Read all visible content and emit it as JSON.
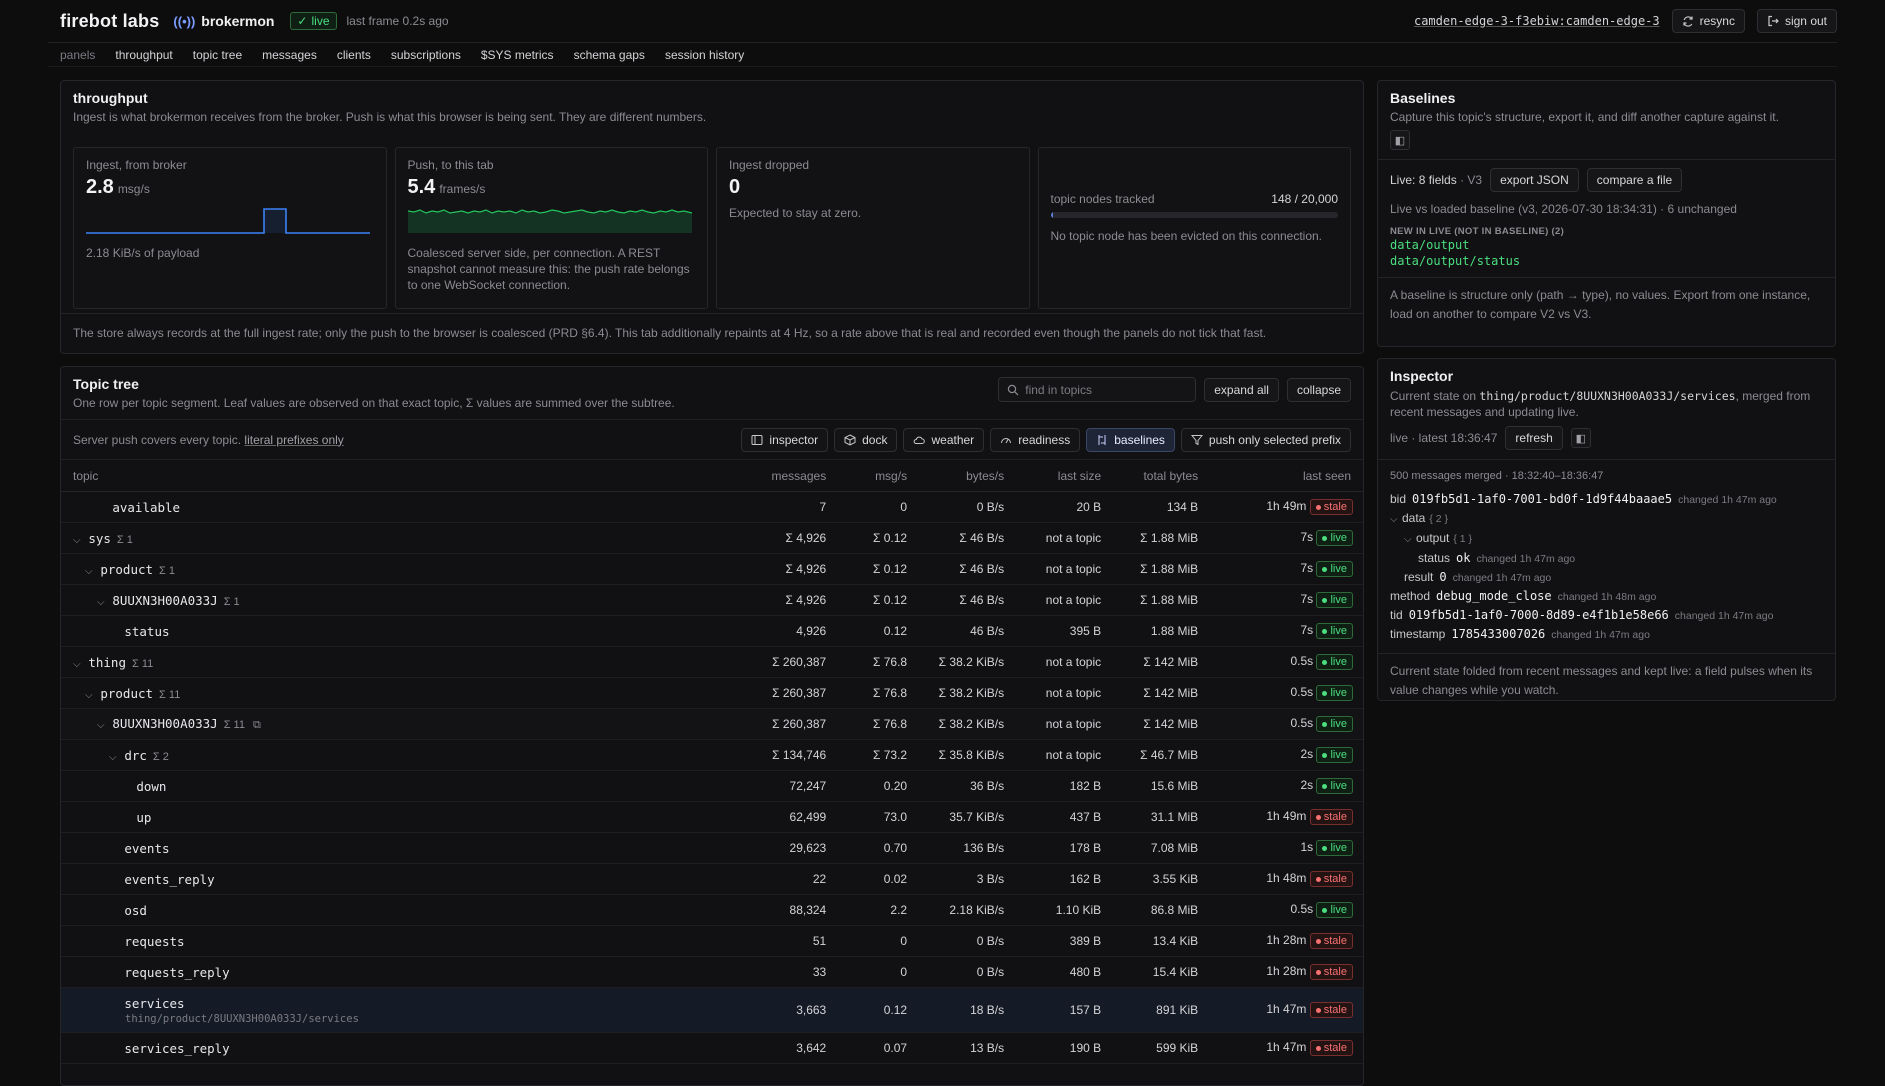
{
  "header": {
    "brand": "firebot labs",
    "app": "brokermon",
    "live_label": "live",
    "last_frame": "last frame 0.2s ago",
    "edge_id": "camden-edge-3-f3ebiw",
    "edge_sep": ":",
    "edge_name": "camden-edge-3",
    "resync": "resync",
    "sign_out": "sign out"
  },
  "nav": {
    "label": "panels",
    "items": [
      "throughput",
      "topic tree",
      "messages",
      "clients",
      "subscriptions",
      "$SYS metrics",
      "schema gaps",
      "session history"
    ]
  },
  "throughput": {
    "title": "throughput",
    "subtitle": "Ingest is what brokermon receives from the broker. Push is what this browser is being sent. They are different numbers.",
    "ingest": {
      "label": "Ingest, from broker",
      "value": "2.8",
      "unit": "msg/s",
      "note": "2.18 KiB/s of payload"
    },
    "push": {
      "label": "Push, to this tab",
      "value": "5.4",
      "unit": "frames/s",
      "note": "Coalesced server side, per connection. A REST snapshot cannot measure this: the push rate belongs to one WebSocket connection."
    },
    "dropped": {
      "label": "Ingest dropped",
      "value": "0",
      "note": "Expected to stay at zero."
    },
    "nodes": {
      "label": "topic nodes tracked",
      "value": "148 / 20,000",
      "fraction": 0.0074,
      "note": "No topic node has been evicted on this connection."
    },
    "footer": "The store always records at the full ingest rate; only the push to the browser is coalesced (PRD §6.4). This tab additionally repaints at 4 Hz, so a rate above that is real and recorded even though the panels do not tick that fast."
  },
  "topic_tree": {
    "title": "Topic tree",
    "subtitle": "One row per topic segment. Leaf values are observed on that exact topic, Σ values are summed over the subtree.",
    "search_placeholder": "find in topics",
    "expand_all": "expand all",
    "collapse": "collapse",
    "server_text": "Server push covers every topic.",
    "server_link": "literal prefixes only",
    "tabs": [
      "inspector",
      "dock",
      "weather",
      "readiness",
      "baselines",
      "push only selected prefix"
    ],
    "columns": [
      "topic",
      "messages",
      "msg/s",
      "bytes/s",
      "last size",
      "total bytes",
      "last seen"
    ],
    "rows": [
      {
        "name": "available",
        "depth": 2,
        "chev": "",
        "sig": "",
        "messages": "7",
        "rate": "0",
        "bytes": "0 B/s",
        "size": "20 B",
        "total": "134 B",
        "seen": "1h 49m",
        "status": "stale"
      },
      {
        "name": "sys",
        "depth": 0,
        "chev": "⌄",
        "sig": "Σ 1",
        "messages": "Σ 4,926",
        "rate": "Σ 0.12",
        "bytes": "Σ 46 B/s",
        "size": "not a topic",
        "total": "Σ 1.88 MiB",
        "seen": "7s",
        "status": "live"
      },
      {
        "name": "product",
        "depth": 1,
        "chev": "⌄",
        "sig": "Σ 1",
        "messages": "Σ 4,926",
        "rate": "Σ 0.12",
        "bytes": "Σ 46 B/s",
        "size": "not a topic",
        "total": "Σ 1.88 MiB",
        "seen": "7s",
        "status": "live"
      },
      {
        "name": "8UUXN3H00A033J",
        "depth": 2,
        "chev": "⌄",
        "sig": "Σ 1",
        "messages": "Σ 4,926",
        "rate": "Σ 0.12",
        "bytes": "Σ 46 B/s",
        "size": "not a topic",
        "total": "Σ 1.88 MiB",
        "seen": "7s",
        "status": "live"
      },
      {
        "name": "status",
        "depth": 3,
        "chev": "",
        "sig": "",
        "messages": "4,926",
        "rate": "0.12",
        "bytes": "46 B/s",
        "size": "395 B",
        "total": "1.88 MiB",
        "seen": "7s",
        "status": "live"
      },
      {
        "name": "thing",
        "depth": 0,
        "chev": "⌄",
        "sig": "Σ 11",
        "messages": "Σ 260,387",
        "rate": "Σ 76.8",
        "bytes": "Σ 38.2 KiB/s",
        "size": "not a topic",
        "total": "Σ 142 MiB",
        "seen": "0.5s",
        "status": "live"
      },
      {
        "name": "product",
        "depth": 1,
        "chev": "⌄",
        "sig": "Σ 11",
        "messages": "Σ 260,387",
        "rate": "Σ 76.8",
        "bytes": "Σ 38.2 KiB/s",
        "size": "not a topic",
        "total": "Σ 142 MiB",
        "seen": "0.5s",
        "status": "live"
      },
      {
        "name": "8UUXN3H00A033J",
        "depth": 2,
        "chev": "⌄",
        "sig": "Σ 11",
        "messages": "Σ 260,387",
        "rate": "Σ 76.8",
        "bytes": "Σ 38.2 KiB/s",
        "size": "not a topic",
        "total": "Σ 142 MiB",
        "seen": "0.5s",
        "status": "live",
        "copy": true,
        "hl": true
      },
      {
        "name": "drc",
        "depth": 3,
        "chev": "⌄",
        "sig": "Σ 2",
        "messages": "Σ 134,746",
        "rate": "Σ 73.2",
        "bytes": "Σ 35.8 KiB/s",
        "size": "not a topic",
        "total": "Σ 46.7 MiB",
        "seen": "2s",
        "status": "live"
      },
      {
        "name": "down",
        "depth": 4,
        "chev": "",
        "sig": "",
        "messages": "72,247",
        "rate": "0.20",
        "bytes": "36 B/s",
        "size": "182 B",
        "total": "15.6 MiB",
        "seen": "2s",
        "status": "live"
      },
      {
        "name": "up",
        "depth": 4,
        "chev": "",
        "sig": "",
        "messages": "62,499",
        "rate": "73.0",
        "bytes": "35.7 KiB/s",
        "size": "437 B",
        "total": "31.1 MiB",
        "seen": "1h 49m",
        "status": "stale"
      },
      {
        "name": "events",
        "depth": 3,
        "chev": "",
        "sig": "",
        "messages": "29,623",
        "rate": "0.70",
        "bytes": "136 B/s",
        "size": "178 B",
        "total": "7.08 MiB",
        "seen": "1s",
        "status": "live"
      },
      {
        "name": "events_reply",
        "depth": 3,
        "chev": "",
        "sig": "",
        "messages": "22",
        "rate": "0.02",
        "bytes": "3 B/s",
        "size": "162 B",
        "total": "3.55 KiB",
        "seen": "1h 48m",
        "status": "stale"
      },
      {
        "name": "osd",
        "depth": 3,
        "chev": "",
        "sig": "",
        "messages": "88,324",
        "rate": "2.2",
        "bytes": "2.18 KiB/s",
        "size": "1.10 KiB",
        "total": "86.8 MiB",
        "seen": "0.5s",
        "status": "live"
      },
      {
        "name": "requests",
        "depth": 3,
        "chev": "",
        "sig": "",
        "messages": "51",
        "rate": "0",
        "bytes": "0 B/s",
        "size": "389 B",
        "total": "13.4 KiB",
        "seen": "1h 28m",
        "status": "stale"
      },
      {
        "name": "requests_reply",
        "depth": 3,
        "chev": "",
        "sig": "",
        "messages": "33",
        "rate": "0",
        "bytes": "0 B/s",
        "size": "480 B",
        "total": "15.4 KiB",
        "seen": "1h 28m",
        "status": "stale"
      },
      {
        "name": "services",
        "depth": 3,
        "chev": "",
        "sig": "",
        "messages": "3,663",
        "rate": "0.12",
        "bytes": "18 B/s",
        "size": "157 B",
        "total": "891 KiB",
        "seen": "1h 47m",
        "status": "stale",
        "sel": true,
        "path": "thing/product/8UUXN3H00A033J/services"
      },
      {
        "name": "services_reply",
        "depth": 3,
        "chev": "",
        "sig": "",
        "messages": "3,642",
        "rate": "0.07",
        "bytes": "13 B/s",
        "size": "190 B",
        "total": "599 KiB",
        "seen": "1h 47m",
        "status": "stale"
      }
    ]
  },
  "baselines": {
    "title": "Baselines",
    "subtitle": "Capture this topic's structure, export it, and diff another capture against it.",
    "live_prefix": "Live:",
    "live_fields": "8 fields",
    "live_version": "· V3",
    "export": "export JSON",
    "compare": "compare a file",
    "diff_line": "Live vs loaded baseline (v3, 2026-07-30 18:34:31) · 6 unchanged",
    "new_heading": "NEW IN LIVE (NOT IN BASELINE) (2)",
    "new_items": [
      "data/output",
      "data/output/status"
    ],
    "footer": "A baseline is structure only (path → type), no values. Export from one instance, load on another to compare V2 vs V3."
  },
  "inspector": {
    "title": "Inspector",
    "subtitle_pre": "Current state on",
    "subtitle_path": "thing/product/8UUXN3H00A033J/services",
    "subtitle_post": ", merged from recent messages and updating live.",
    "status": "live · latest 18:36:47",
    "refresh": "refresh",
    "merged": "500 messages merged · 18:32:40–18:36:47",
    "fields": [
      {
        "indent": 0,
        "chev": "",
        "key": "bid",
        "val": "019fb5d1-1af0-7001-bd0f-1d9f44baaae5",
        "changed": "changed 1h 47m ago"
      },
      {
        "indent": 0,
        "chev": "⌄",
        "key": "data",
        "val": "",
        "brace": "{ 2 }",
        "changed": ""
      },
      {
        "indent": 1,
        "chev": "⌄",
        "key": "output",
        "val": "",
        "brace": "{ 1 }",
        "changed": ""
      },
      {
        "indent": 2,
        "chev": "",
        "key": "status",
        "val": "ok",
        "changed": "changed 1h 47m ago"
      },
      {
        "indent": 1,
        "chev": "",
        "key": "result",
        "val": "0",
        "changed": "changed 1h 47m ago"
      },
      {
        "indent": 0,
        "chev": "",
        "key": "method",
        "val": "debug_mode_close",
        "changed": "changed 1h 48m ago"
      },
      {
        "indent": 0,
        "chev": "",
        "key": "tid",
        "val": "019fb5d1-1af0-7000-8d89-e4f1b1e58e66",
        "changed": "changed 1h 47m ago"
      },
      {
        "indent": 0,
        "chev": "",
        "key": "timestamp",
        "val": "1785433007026",
        "changed": "changed 1h 47m ago"
      }
    ],
    "footer": "Current state folded from recent messages and kept live: a field pulses when its value changes while you watch."
  },
  "colors": {
    "live": "#4ade80",
    "stale": "#f87171",
    "ingest_line": "#3b82f6",
    "push_line": "#22c55e"
  }
}
